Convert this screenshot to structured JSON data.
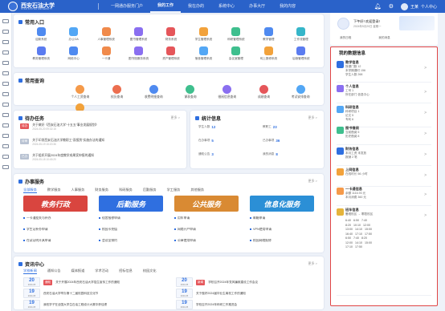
{
  "header": {
    "brand_title": "西安石油大学",
    "brand_sub": "XI'AN SHIYOU UNIVERSITY",
    "nav": [
      "一网通办服务门户",
      "我的工作",
      "我在办的",
      "系统中心",
      "办事大厅",
      "我的内容"
    ],
    "active_nav": 1,
    "user_name": "王某",
    "user_role": "个人中心"
  },
  "profile": {
    "greeting": "下午好! 欢迎登录!",
    "subtitle": "2024年5月20日 星期一",
    "actions": [
      "我的日程",
      "我的消息"
    ]
  },
  "entry": {
    "title": "常用入口",
    "more": "更多 >",
    "items": [
      {
        "label": "迎新系统",
        "color": "#4f8af0"
      },
      {
        "label": "办公OA",
        "color": "#53a7f5"
      },
      {
        "label": "人事管理系统",
        "color": "#f08a4b"
      },
      {
        "label": "图书管理系统",
        "color": "#8a6ff0"
      },
      {
        "label": "财务系统",
        "color": "#e5565a"
      },
      {
        "label": "学生管理系统",
        "color": "#f2a23b"
      },
      {
        "label": "科研管理系统",
        "color": "#3fbf8e"
      },
      {
        "label": "教学管理",
        "color": "#4f8af0"
      },
      {
        "label": "工作流管理",
        "color": "#36b6c9"
      },
      {
        "label": "教务管理系统",
        "color": "#5b7cf0"
      },
      {
        "label": "网络中心",
        "color": "#4f8af0"
      },
      {
        "label": "一卡通",
        "color": "#f08a4b"
      },
      {
        "label": "图书馆服务系统",
        "color": "#8a6ff0"
      },
      {
        "label": "资产管理系统",
        "color": "#e5565a"
      },
      {
        "label": "宿舍管理系统",
        "color": "#53a7f5"
      },
      {
        "label": "会议室管理",
        "color": "#3fbf8e"
      },
      {
        "label": "网上报修系统",
        "color": "#f2a23b"
      },
      {
        "label": "后勤管理系统",
        "color": "#5b7cf0"
      }
    ]
  },
  "query": {
    "title": "常用查询",
    "items": [
      {
        "label": "个人工资查询",
        "color": "#f59a4a"
      },
      {
        "label": "校历查询",
        "color": "#ec6e4f"
      },
      {
        "label": "收费明细查询",
        "color": "#4f8af0"
      },
      {
        "label": "课表查询",
        "color": "#3fbf8e"
      },
      {
        "label": "借阅信息查询",
        "color": "#8a6ff0"
      },
      {
        "label": "成绩查询",
        "color": "#e5565a"
      },
      {
        "label": "考试安排查询",
        "color": "#53a7f5"
      },
      {
        "label": "一卡通消费查询",
        "color": "#f2a23b"
      }
    ]
  },
  "todo": {
    "title": "待办任务",
    "more": "更多 >",
    "rows": [
      {
        "tag": "待办",
        "color": "#e5565a",
        "text": "关于做好《西安石油大学“十五五”事业发展规划》",
        "date": "2024-05-20 09:32:15"
      },
      {
        "tag": "待审",
        "color": "#b8c2d2",
        "text": "关于印发西安石油大学教职工“双报到”实施办法的通知",
        "date": "2024-05-19 15:20:36"
      },
      {
        "tag": "已办",
        "color": "#b8c2d2",
        "text": "关于组织开展2024年度教学成果奖申报的通知",
        "date": "2024-05-18 10:45:20"
      }
    ]
  },
  "stats": {
    "title": "统计信息",
    "more": "更多 >",
    "items": [
      {
        "label": "学生人数",
        "value": "12"
      },
      {
        "label": "教职工",
        "value": "23"
      },
      {
        "label": "在办事项",
        "value": "5"
      },
      {
        "label": "已办事项",
        "value": "36"
      },
      {
        "label": "通知公告",
        "value": "3"
      },
      {
        "label": "我的消息",
        "value": "8"
      }
    ]
  },
  "hall": {
    "title": "办事服务",
    "more": "更多 >",
    "tabs": [
      "全部服务",
      "教学服务",
      "人事服务",
      "财务服务",
      "科研服务",
      "后勤服务",
      "学工服务",
      "其他服务"
    ],
    "cols": [
      {
        "banner": "教务行政",
        "color": "#d9453f",
        "items": [
          "一卡通挂失与补办",
          "学生证补办申请",
          "在读证明开具申请"
        ]
      },
      {
        "banner": "后勤服务",
        "color": "#2f6fe0",
        "items": [
          "宿舍报修申请",
          "校园卡充值",
          "会议室预约"
        ]
      },
      {
        "banner": "公共服务",
        "color": "#d98a33",
        "items": [
          "用车申请",
          "网络开户申请",
          "公章使用申请"
        ]
      },
      {
        "banner": "信息化服务",
        "color": "#2b8fd6",
        "items": [
          "邮箱申请",
          "VPN使用申请",
          "校园网络报修"
        ]
      }
    ]
  },
  "news": {
    "title": "资讯中心",
    "more": "更多 >",
    "tabs": [
      "学校新闻",
      "通知公告",
      "媒体报道",
      "学术活动",
      "招标信息",
      "校园文化"
    ],
    "items": [
      {
        "day": "20",
        "ym": "2024-05",
        "tag": "通知",
        "text": "关于开展2024年西安石油大学招生宣传工作的通知"
      },
      {
        "day": "20",
        "ym": "2024-05",
        "tag": "新闻",
        "text": "学校召开2024年党风廉政建设工作会议"
      },
      {
        "day": "19",
        "ym": "2024-05",
        "tag": "",
        "text": "西安石油大学举办第十二届校园科技文化节"
      },
      {
        "day": "19",
        "ym": "2024-05",
        "tag": "",
        "text": "关于做好2024届毕业生离校工作的通知"
      },
      {
        "day": "19",
        "ym": "2024-05",
        "tag": "",
        "text": "我校学子在全国大学生石油工程设计大赛中获佳绩"
      },
      {
        "day": "19",
        "ym": "2024-05",
        "tag": "",
        "text": "学校召开2024年科研工作推进会"
      }
    ]
  },
  "services": {
    "title": "我的数据信息",
    "items": [
      {
        "name": "教学信息",
        "color": "#2f6fe0",
        "lines": [
          "授课门数 12",
          "本学期课时 156",
          "学生人数 268"
        ]
      },
      {
        "name": "个人信息",
        "color": "#8a6ff0",
        "lines": [
          "工号 1",
          "所在部门 信息中心"
        ]
      },
      {
        "name": "科研信息",
        "color": "#53a7f5",
        "lines": [
          "科研项目 1",
          "论文 5",
          "专利 6"
        ]
      },
      {
        "name": "图书借阅",
        "color": "#3fbf8e",
        "lines": [
          "当前借阅 5",
          "历史借阅 8"
        ]
      },
      {
        "name": "财务信息",
        "color": "#2f6fe0",
        "lines": [
          "本月工资 未发放",
          "报销 2 笔"
        ]
      },
      {
        "name": "上网信息",
        "color": "#f2a23b",
        "lines": [
          "在线时长 56 小时"
        ]
      },
      {
        "name": "一卡通信息",
        "color": "#f59a4a",
        "lines": [
          "余额 1116.93 元",
          "本月消费 360 元"
        ]
      },
      {
        "name": "班车信息",
        "color": "#e5b43b",
        "lines": [
          "雁塔校区 → 鄠邑校区"
        ]
      }
    ],
    "bus_times": "6:40   6:50   7:40\n8:20   10:10   12:00\n13:00   14:10   15:00\n16:40   17:10   17:50\n6:50   7:40   8:20\n12:00   14:10   15:00\n17:10   17:50"
  }
}
